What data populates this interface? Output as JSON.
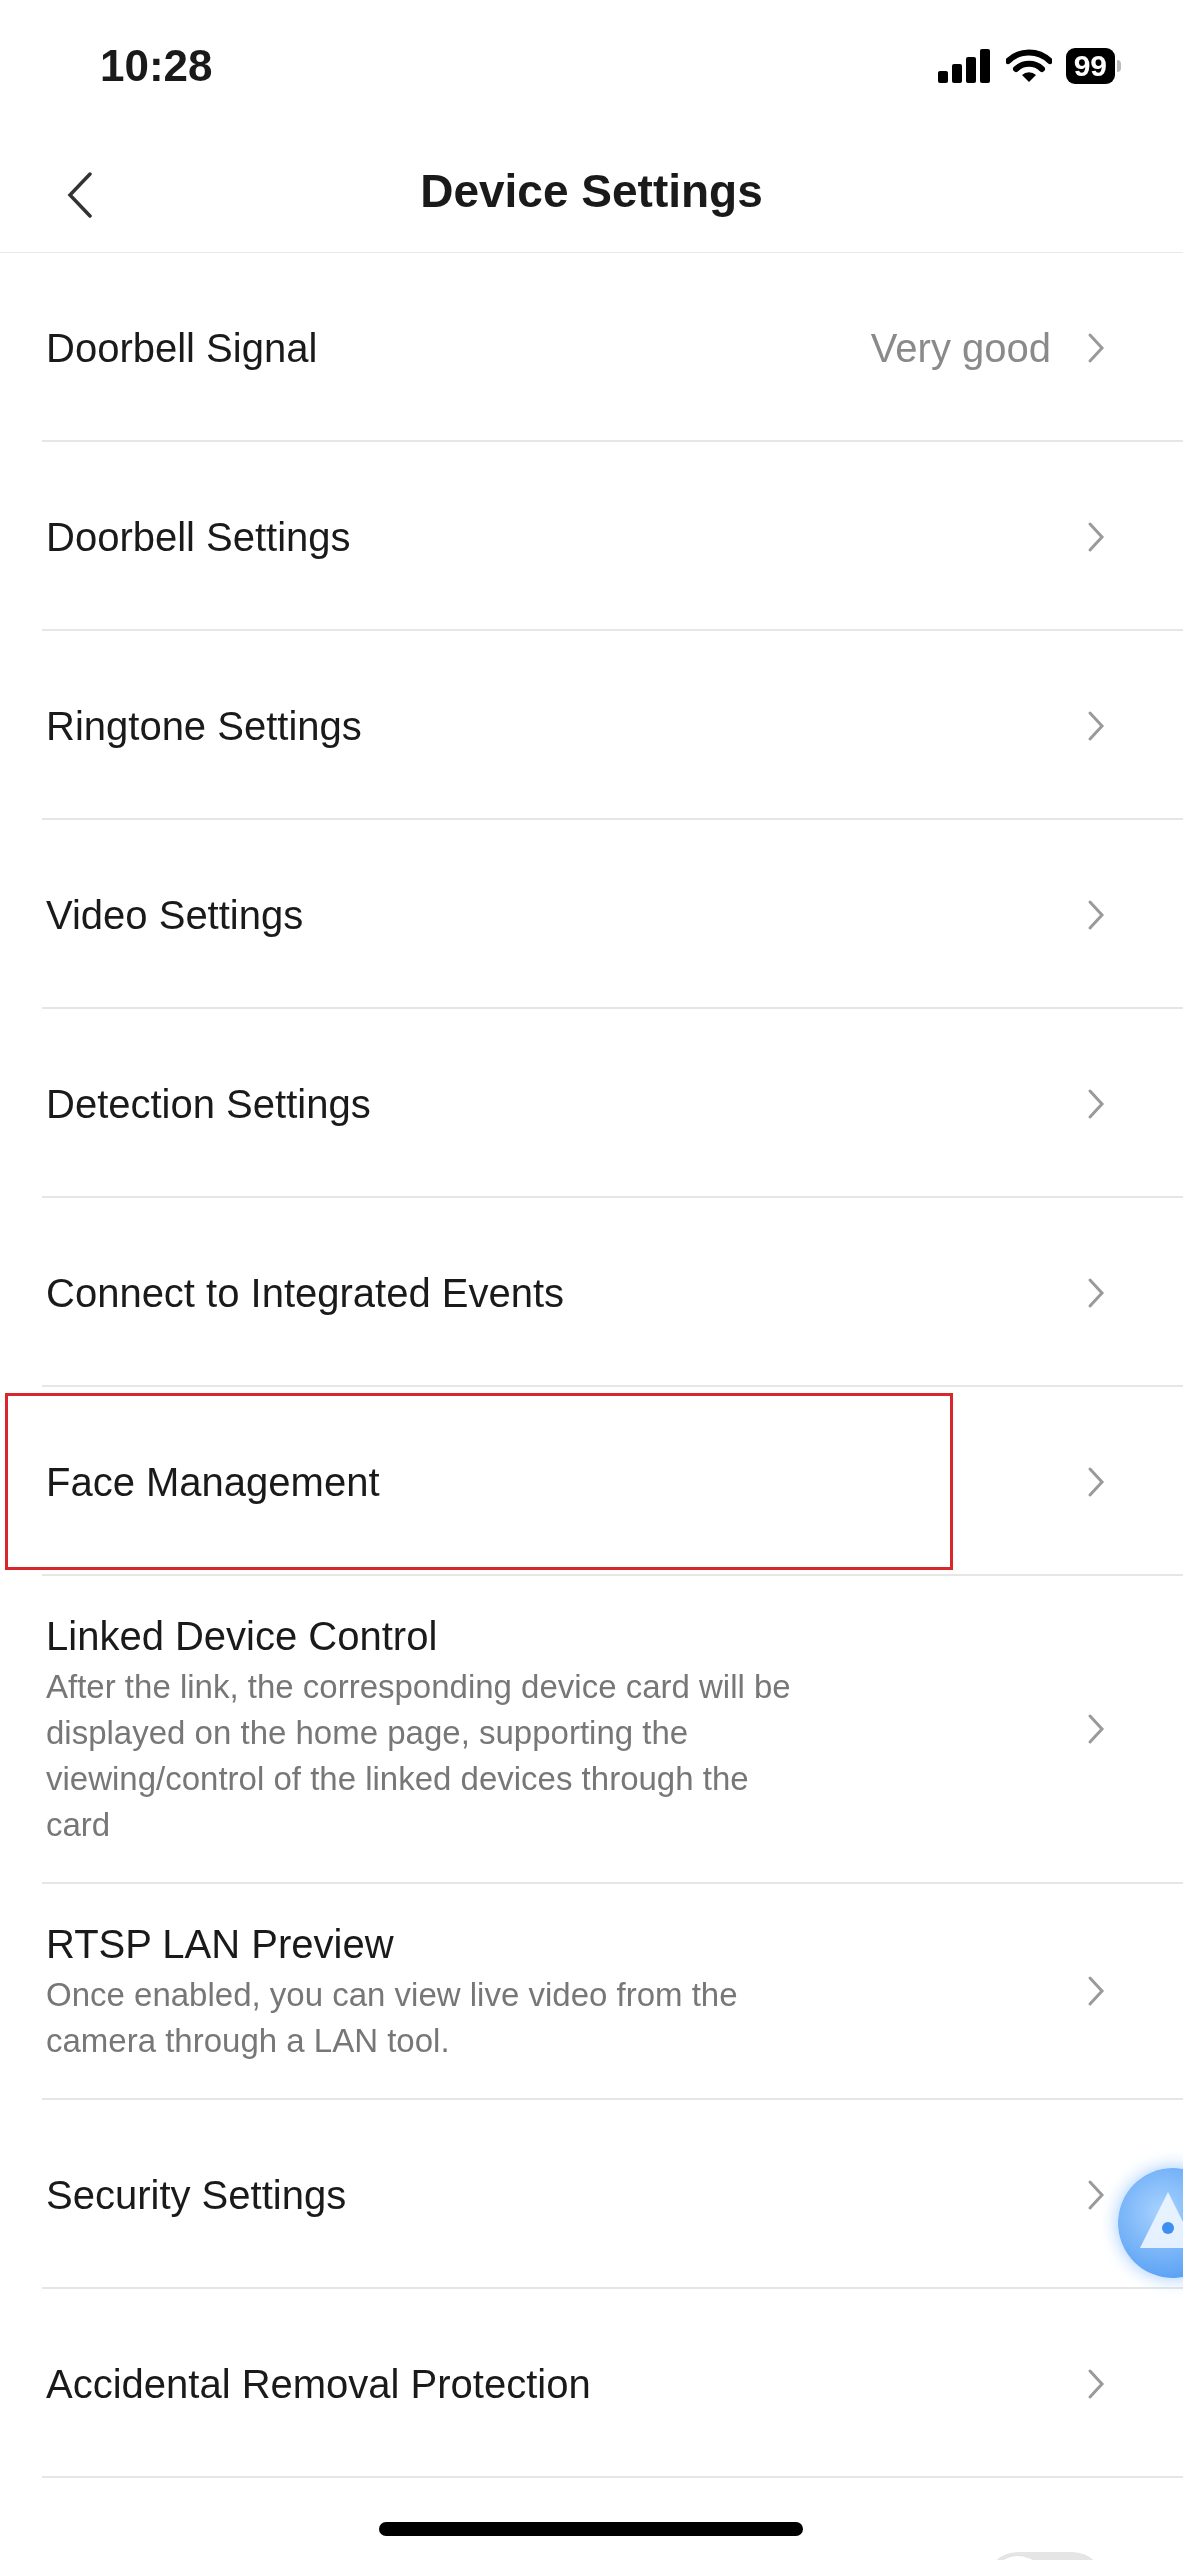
{
  "status_bar": {
    "time": "10:28",
    "battery": "99"
  },
  "header": {
    "title": "Device Settings"
  },
  "items": [
    {
      "kind": "link",
      "label": "Doorbell Signal",
      "value": "Very good",
      "highlighted": false
    },
    {
      "kind": "link",
      "label": "Doorbell Settings",
      "highlighted": false
    },
    {
      "kind": "link",
      "label": "Ringtone Settings",
      "highlighted": false
    },
    {
      "kind": "link",
      "label": "Video Settings",
      "highlighted": false
    },
    {
      "kind": "link",
      "label": "Detection Settings",
      "highlighted": false
    },
    {
      "kind": "link",
      "label": "Connect to Integrated Events",
      "highlighted": false
    },
    {
      "kind": "link",
      "label": "Face Management",
      "highlighted": true
    },
    {
      "kind": "link",
      "label": "Linked Device Control",
      "description": "After the link, the corresponding device card will be displayed on the home page, supporting the viewing/control of the linked devices through the card",
      "highlighted": false
    },
    {
      "kind": "link",
      "label": "RTSP LAN Preview",
      "description": "Once enabled, you can view live video from the camera through a LAN tool.",
      "highlighted": false
    },
    {
      "kind": "link",
      "label": "Security Settings",
      "highlighted": false
    },
    {
      "kind": "link",
      "label": "Accidental Removal Protection",
      "highlighted": false
    },
    {
      "kind": "toggle",
      "on": false,
      "highlighted": false
    }
  ]
}
